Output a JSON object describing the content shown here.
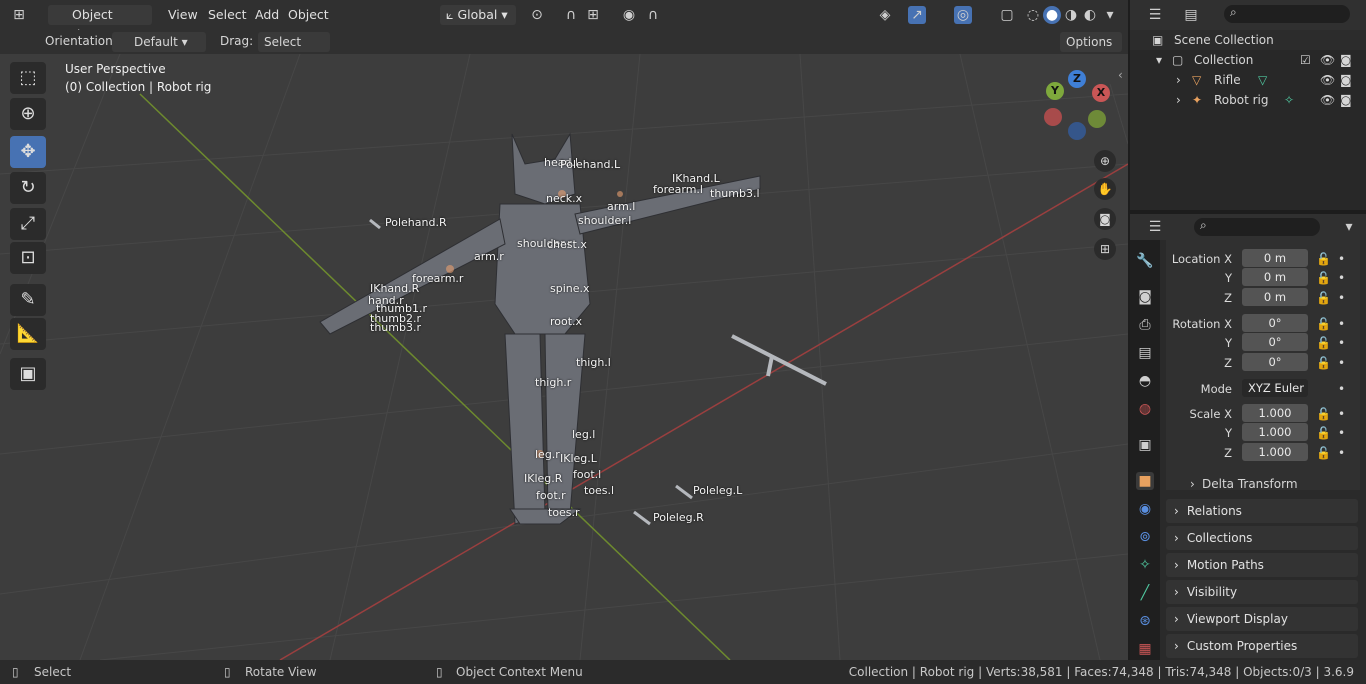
{
  "header": {
    "mode": "Object Mode",
    "menus": [
      "View",
      "Select",
      "Add",
      "Object"
    ],
    "transform_orientation": "Global"
  },
  "tool_header": {
    "orientation_label": "Orientation:",
    "orientation_value": "Default",
    "drag_label": "Drag:",
    "drag_value": "Select Box",
    "options": "Options"
  },
  "viewport": {
    "perspective": "User Perspective",
    "context": "(0) Collection | Robot rig",
    "gizmo": {
      "x": "X",
      "y": "Y",
      "z": "Z"
    },
    "bones": [
      "head.l",
      "Polehand.L",
      "neck.x",
      "IKhand.L",
      "forearm.l",
      "thumb3.l",
      "arm.l",
      "shoulder.l",
      "Polehand.R",
      "shoulder.r",
      "chest.x",
      "arm.r",
      "forearm.r",
      "IKhand.R",
      "hand.r",
      "thumb1.r",
      "thumb2.r",
      "thumb3.r",
      "spine.x",
      "root.x",
      "thigh.l",
      "thigh.r",
      "leg.l",
      "leg.r",
      "IKleg.L",
      "foot.l",
      "IKleg.R",
      "toes.l",
      "foot.r",
      "toes.r",
      "Poleleg.L",
      "Poleleg.R"
    ]
  },
  "outliner": {
    "root": "Scene Collection",
    "collection": "Collection",
    "items": [
      "Rifle",
      "Robot rig"
    ]
  },
  "properties": {
    "location": {
      "label": "Location X",
      "x": "0 m",
      "y": "0 m",
      "z": "0 m"
    },
    "rotation": {
      "label": "Rotation X",
      "x": "0°",
      "y": "0°",
      "z": "0°"
    },
    "mode_label": "Mode",
    "mode_value": "XYZ Euler",
    "scale": {
      "label": "Scale X",
      "x": "1.000",
      "y": "1.000",
      "z": "1.000"
    },
    "axis_y": "Y",
    "axis_z": "Z",
    "delta": "Delta Transform",
    "panels": [
      "Relations",
      "Collections",
      "Motion Paths",
      "Visibility",
      "Viewport Display",
      "Custom Properties"
    ]
  },
  "status": {
    "select": "Select",
    "rotate": "Rotate View",
    "context_menu": "Object Context Menu",
    "stats": "Collection | Robot rig | Verts:38,581 | Faces:74,348 | Tris:74,348 | Objects:0/3 | 3.6.9"
  },
  "colors": {
    "accent": "#4772b3",
    "x_axis": "#c95656",
    "y_axis": "#7ea83c",
    "z_axis": "#3f7fd6"
  }
}
